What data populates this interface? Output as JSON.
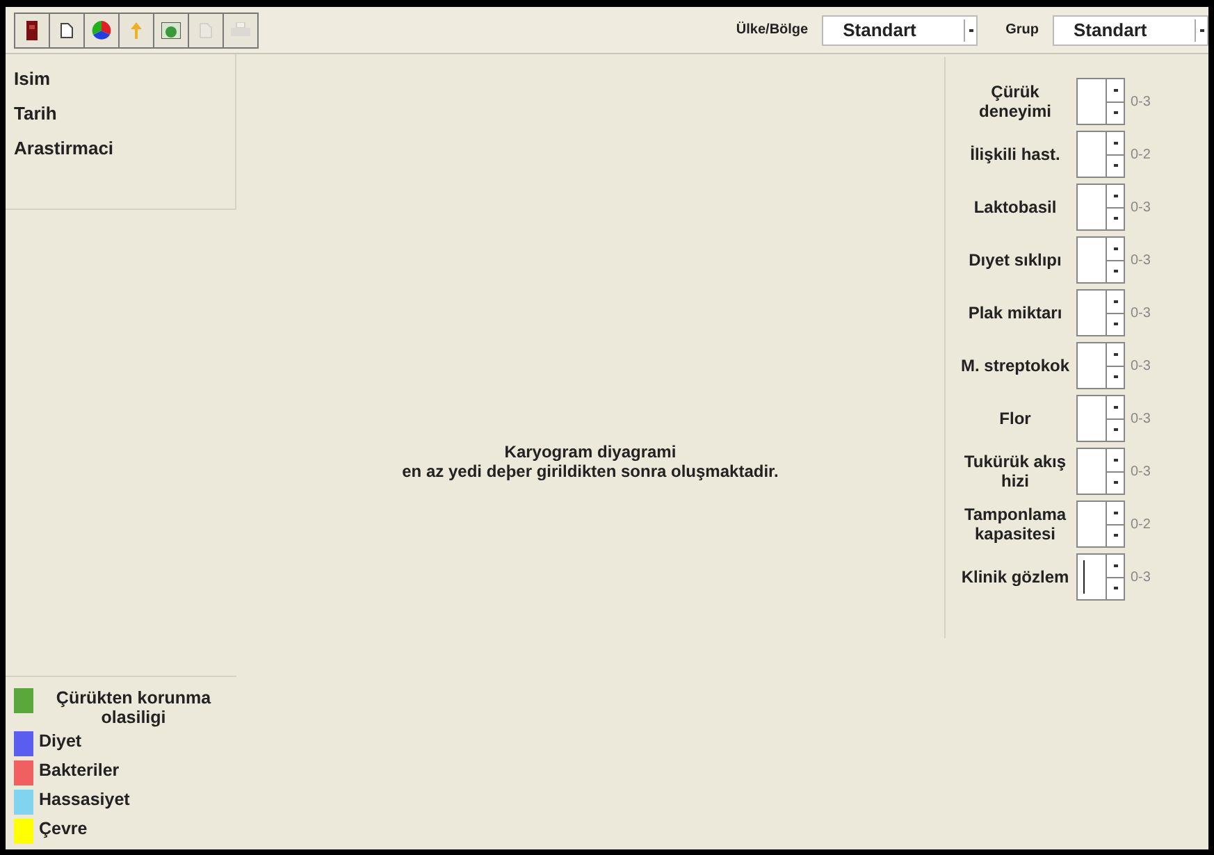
{
  "toolbar": [
    {
      "disabled": false
    },
    {
      "disabled": false
    },
    {
      "disabled": false
    },
    {
      "disabled": false
    },
    {
      "disabled": false
    },
    {
      "disabled": true
    },
    {
      "disabled": true
    }
  ],
  "selectors": [
    {
      "label": "Ülke/Bölge",
      "value": "Standart"
    },
    {
      "label": "Grup",
      "value": "Standart"
    }
  ],
  "patient_info": [
    "Isim",
    "Tarih",
    "Arastirmaci"
  ],
  "message": [
    "Karyogram diyagrami",
    "en az yedi deþer girildikten sonra oluşmaktadir."
  ],
  "factors": [
    {
      "label": "Çürük deneyimi",
      "range": "0-3",
      "focused": false
    },
    {
      "label": "İlişkili hast.",
      "range": "0-2",
      "focused": false
    },
    {
      "label": "Laktobasil",
      "range": "0-3",
      "focused": false
    },
    {
      "label": "Dıyet sıklıpı",
      "range": "0-3",
      "focused": false
    },
    {
      "label": "Plak miktarı",
      "range": "0-3",
      "focused": false
    },
    {
      "label": "M. streptokok",
      "range": "0-3",
      "focused": false
    },
    {
      "label": "Flor",
      "range": "0-3",
      "focused": false
    },
    {
      "label": "Tukürük akış hizi",
      "range": "0-3",
      "focused": false
    },
    {
      "label": "Tamponlama kapasitesi",
      "range": "0-2",
      "focused": false
    },
    {
      "label": "Klinik gözlem",
      "range": "0-3",
      "focused": true
    }
  ],
  "legend": [
    {
      "label": "Çürükten korunma olasiligi",
      "color": "#5aa83c"
    },
    {
      "label": "Diyet",
      "color": "#5a5ef0"
    },
    {
      "label": "Bakteriler",
      "color": "#f06060"
    },
    {
      "label": "Hassasiyet",
      "color": "#80d4f0"
    },
    {
      "label": "Çevre",
      "color": "#ffff00"
    }
  ]
}
